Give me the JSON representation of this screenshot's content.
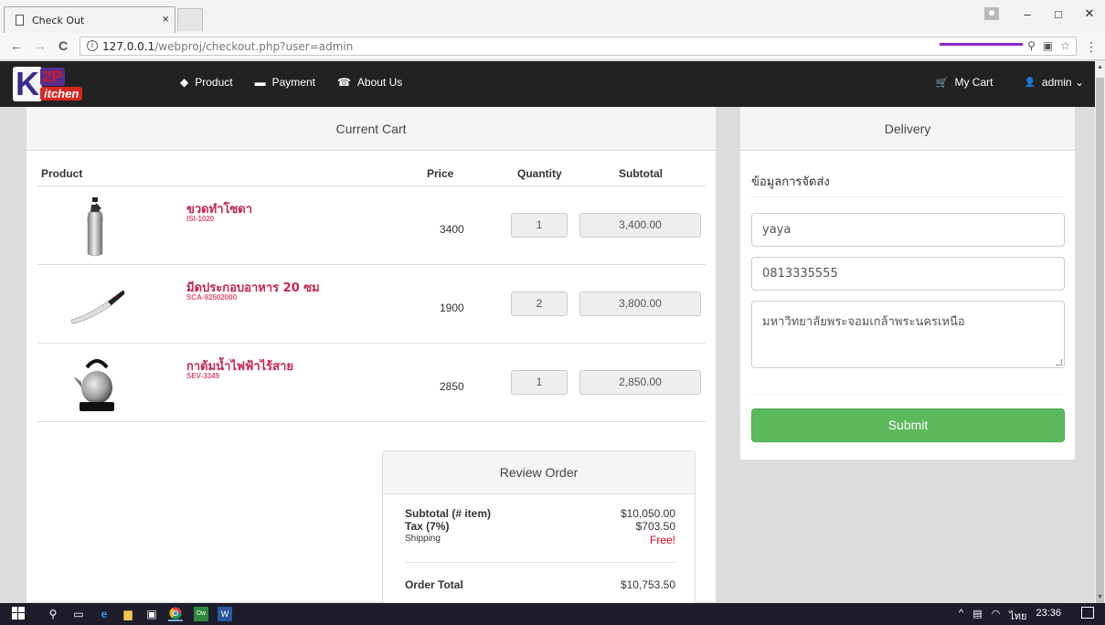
{
  "browser": {
    "tab_title": "Check Out",
    "tab_close": "×",
    "url_host": "127.0.0.1",
    "url_path": "/webproj/checkout.php?user=admin",
    "back": "←",
    "forward": "→",
    "reload": "C",
    "info": "i",
    "zoom_icon": "⚲",
    "translate_icon": "▣",
    "star_icon": "☆",
    "menu_icon": "⋮",
    "minimize": "–",
    "maximize": "□",
    "close": "✕"
  },
  "nav": {
    "logo_k": "K",
    "logo_2p": "2P",
    "logo_itchen": "itchen",
    "links": [
      {
        "icon": "tag-icon",
        "glyph": "◆",
        "label": "Product"
      },
      {
        "icon": "credit-card-icon",
        "glyph": "▬",
        "label": "Payment"
      },
      {
        "icon": "phone-icon",
        "glyph": "☎",
        "label": "About Us"
      }
    ],
    "cart": {
      "icon": "cart-icon",
      "glyph": "🛒",
      "label": "My Cart"
    },
    "user": {
      "icon": "user-icon",
      "glyph": "👤",
      "label": "admin ⌄"
    }
  },
  "cart": {
    "title": "Current Cart",
    "columns": {
      "product": "Product",
      "price": "Price",
      "quantity": "Quantity",
      "subtotal": "Subtotal"
    },
    "items": [
      {
        "name": "ขวดทำโซดา",
        "sku": "ISI-1020",
        "price": "3400",
        "qty": "1",
        "subtotal": "3,400.00",
        "image": "soda-bottle"
      },
      {
        "name": "มีดประกอบอาหาร 20 ซม",
        "sku": "SCA-92502000",
        "price": "1900",
        "qty": "2",
        "subtotal": "3,800.00",
        "image": "kitchen-knife"
      },
      {
        "name": "กาต้มน้ำไฟฟ้าไร้สาย",
        "sku": "SEV-3349",
        "price": "2850",
        "qty": "1",
        "subtotal": "2,850.00",
        "image": "electric-kettle"
      }
    ]
  },
  "review": {
    "title": "Review Order",
    "subtotal_label": "Subtotal (# item)",
    "subtotal_value": "$10,050.00",
    "tax_label": "Tax (7%)",
    "tax_value": "$703.50",
    "shipping_label": "Shipping",
    "shipping_value": "Free!",
    "total_label": "Order Total",
    "total_value": "$10,753.50"
  },
  "delivery": {
    "title": "Delivery",
    "section_title": "ข้อมูลการจัดส่ง",
    "name_value": "yaya",
    "phone_value": "0813335555",
    "address_value": "มหาวิทยาลัยพระจอมเกล้าพระนครเหนือ",
    "submit_label": "Submit"
  },
  "taskbar": {
    "tray_lang": "ไทย",
    "tray_time": "23:36",
    "tray_up": "^"
  },
  "colors": {
    "navbar": "#222222",
    "accent_underline": "#8b26c9",
    "product_name": "#c7254e",
    "submit": "#5cb85c",
    "free": "#d9001b"
  }
}
